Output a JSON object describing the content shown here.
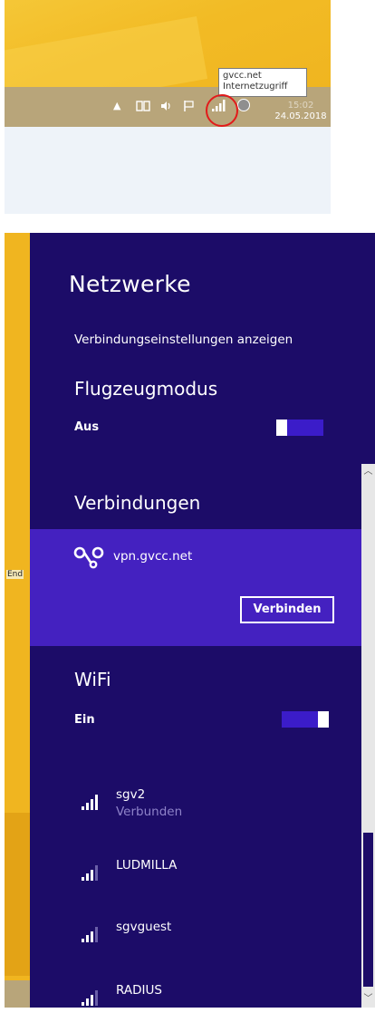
{
  "taskbar": {
    "tooltip_line1": "gvcc.net",
    "tooltip_line2": "Internetzugriff",
    "time": "15:02",
    "date": "24.05.2018"
  },
  "desktop": {
    "partial_label": "End"
  },
  "network_panel": {
    "title": "Netzwerke",
    "connection_settings_link": "Verbindungseinstellungen anzeigen",
    "airplane_mode": {
      "title": "Flugzeugmodus",
      "state": "Aus",
      "toggle_on": false
    },
    "connections": {
      "title": "Verbindungen",
      "vpn": {
        "name": "vpn.gvcc.net",
        "connect_label": "Verbinden"
      }
    },
    "wifi": {
      "title": "WiFi",
      "state": "Ein",
      "toggle_on": true,
      "networks": [
        {
          "name": "sgv2",
          "status": "Verbunden"
        },
        {
          "name": "LUDMILLA"
        },
        {
          "name": "sgvguest"
        },
        {
          "name": "RADIUS"
        }
      ]
    }
  },
  "colors": {
    "panel_bg": "#1c0c68",
    "selected_bg": "#4421c0",
    "accent_toggle": "#3b1cc9",
    "desktop_yellow": "#f0b520",
    "annotation_red": "#e21b1b"
  }
}
